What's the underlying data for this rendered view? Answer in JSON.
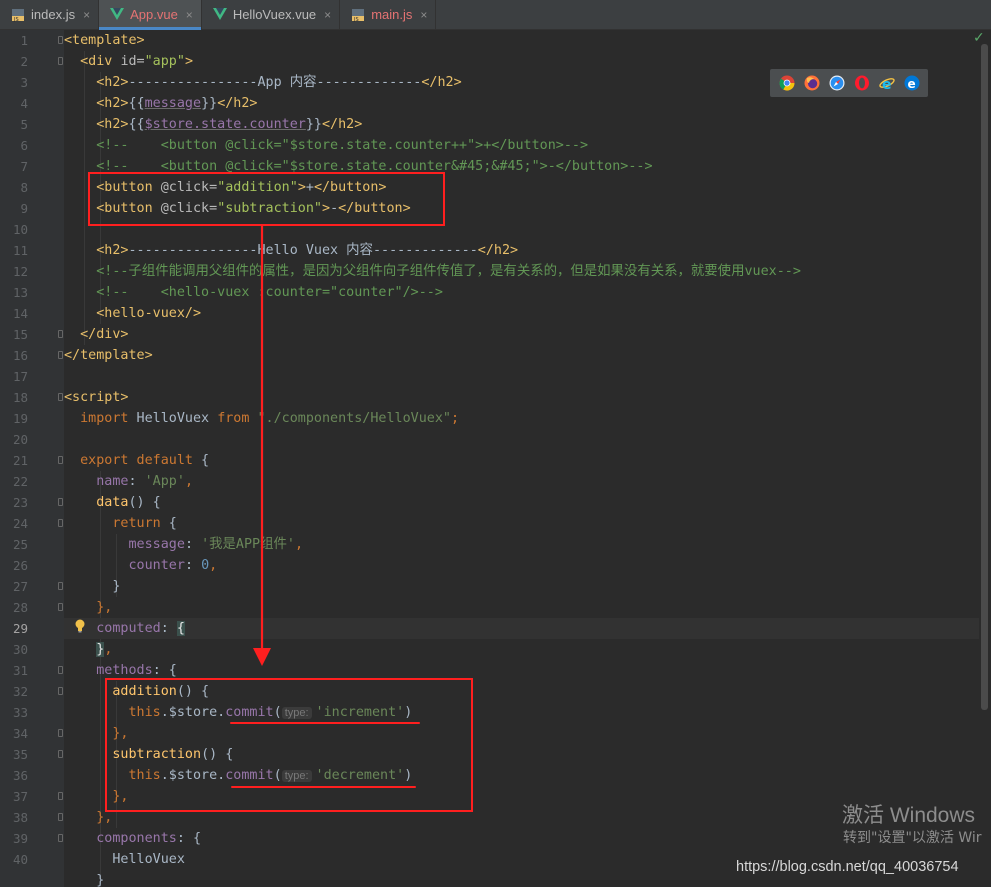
{
  "tabs": [
    {
      "label": "index.js",
      "icon": "js-file-icon",
      "active": false
    },
    {
      "label": "App.vue",
      "icon": "vue-file-icon",
      "active": true
    },
    {
      "label": "HelloVuex.vue",
      "icon": "vue-file-icon",
      "active": false
    },
    {
      "label": "main.js",
      "icon": "js-file-icon",
      "active": false
    }
  ],
  "tab_close_glyph": "×",
  "line_numbers": [
    "1",
    "2",
    "3",
    "4",
    "5",
    "6",
    "7",
    "8",
    "9",
    "10",
    "11",
    "12",
    "13",
    "14",
    "15",
    "16",
    "17",
    "18",
    "19",
    "20",
    "21",
    "22",
    "23",
    "24",
    "25",
    "26",
    "27",
    "28",
    "29",
    "30",
    "31",
    "32",
    "33",
    "34",
    "35",
    "36",
    "37",
    "38",
    "39",
    "40"
  ],
  "current_line": "29",
  "code": {
    "l1_tag": "<template>",
    "l2_open": "<div ",
    "l2_attr": "id=",
    "l2_val": "\"app\"",
    "l2_close": ">",
    "l3_open": "<h2>",
    "l3_text": "----------------App 内容-------------",
    "l3_close": "</h2>",
    "l4_open": "<h2>",
    "l4_a": "{{",
    "l4_var": "message",
    "l4_b": "}}",
    "l4_close": "</h2>",
    "l5_open": "<h2>",
    "l5_a": "{{",
    "l5_var": "$store.state.counter",
    "l5_b": "}}",
    "l5_close": "</h2>",
    "l6": "<!--    <button @click=\"$store.state.counter++\">+</button>-->",
    "l7": "<!--    <button @click=\"$store.state.counter&#45;&#45;\">-</button>-->",
    "l8_open": "<button ",
    "l8_attr": "@click=",
    "l8_val": "\"addition\"",
    "l8_gt": ">",
    "l8_text": "+",
    "l8_close": "</button>",
    "l9_open": "<button ",
    "l9_attr": "@click=",
    "l9_val": "\"subtraction\"",
    "l9_gt": ">",
    "l9_text": "-",
    "l9_close": "</button>",
    "l11_open": "<h2>",
    "l11_text": "----------------Hello Vuex 内容-------------",
    "l11_close": "</h2>",
    "l12": "<!--子组件能调用父组件的属性，是因为父组件向子组件传值了，是有关系的，但是如果没有关系，就要使用vuex-->",
    "l13": "<!--    <hello-vuex :counter=\"counter\"/>-->",
    "l14": "<hello-vuex/>",
    "l15": "</div>",
    "l16": "</template>",
    "l18": "<script>",
    "l19_kw1": "import",
    "l19_name": " HelloVuex ",
    "l19_kw2": "from",
    "l19_str": " \"./components/HelloVuex\"",
    "l19_semi": ";",
    "l21_kw": "export default",
    "l21_rest": " {",
    "l22_prop": "name",
    "l22_colon": ": ",
    "l22_str": "'App'",
    "l22_comma": ",",
    "l23_fn": "data",
    "l23_rest": "() {",
    "l24_kw": "return",
    "l24_rest": " {",
    "l25_prop": "message",
    "l25_colon": ": ",
    "l25_str": "'我是APP组件'",
    "l25_comma": ",",
    "l26_prop": "counter",
    "l26_colon": ": ",
    "l26_num": "0",
    "l26_comma": ",",
    "l27": "}",
    "l28": "},",
    "l29_prop": "computed",
    "l29_colon": ": ",
    "l29_brace": "{",
    "l30_brace": "}",
    "l30_comma": ",",
    "l31_prop": "methods",
    "l31_rest": ": {",
    "l32_fn": "addition",
    "l32_rest": "() {",
    "l33_kw": "this",
    "l33_mid": ".$store.",
    "l33_fn": "commit",
    "l33_paren": "(",
    "l33_hint": "type:",
    "l33_str": "'increment'",
    "l33_end": ")",
    "l34": "},",
    "l35_fn": "subtraction",
    "l35_rest": "() {",
    "l36_kw": "this",
    "l36_mid": ".$store.",
    "l36_fn": "commit",
    "l36_paren": "(",
    "l36_hint": "type:",
    "l36_str": "'decrement'",
    "l36_end": ")",
    "l37": "},",
    "l38": "},",
    "l39_prop": "components",
    "l39_rest": ": {",
    "l40": "HelloVuex",
    "l41": "}"
  },
  "browser_icons": [
    "chrome-icon",
    "firefox-icon",
    "safari-icon",
    "opera-icon",
    "ie-icon",
    "edge-icon"
  ],
  "watermark": {
    "activate_title": "激活 Windows",
    "activate_sub": "转到\"设置\"以激活 Wir",
    "blog_url": "https://blog.csdn.net/qq_40036754"
  },
  "colors": {
    "annotation_red": "#ff1f1f",
    "editor_bg": "#2b2b2b",
    "tag": "#e8bf6a",
    "string": "#6a8759",
    "keyword": "#cc7832"
  }
}
